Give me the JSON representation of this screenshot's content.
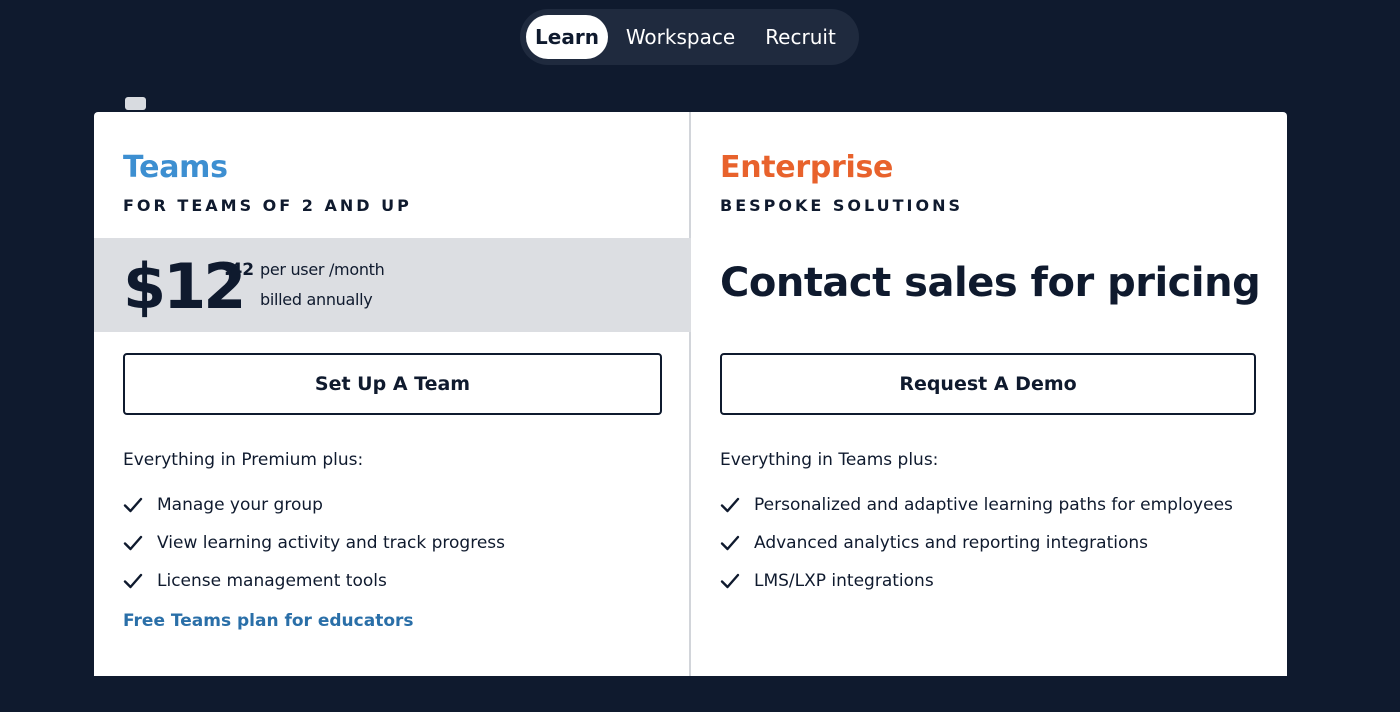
{
  "tabs": [
    {
      "label": "Learn",
      "active": true
    },
    {
      "label": "Workspace",
      "active": false
    },
    {
      "label": "Recruit",
      "active": false
    }
  ],
  "teams": {
    "name": "Teams",
    "subtitle": "FOR TEAMS OF 2 AND UP",
    "price": {
      "amount": "$12",
      "cents": ".42",
      "unit": "per user /month",
      "billing": "billed annually"
    },
    "cta_label": "Set Up A Team",
    "features_intro": "Everything in Premium plus:",
    "features": [
      "Manage your group",
      "View learning activity and track progress",
      "License management tools"
    ],
    "link_label": "Free Teams plan for educators"
  },
  "enterprise": {
    "name": "Enterprise",
    "subtitle": "BESPOKE SOLUTIONS",
    "contact": "Contact sales for pricing",
    "cta_label": "Request A Demo",
    "features_intro": "Everything in Teams plus:",
    "features": [
      "Personalized and adaptive learning paths for employees",
      "Advanced analytics and reporting integrations",
      "LMS/LXP integrations"
    ]
  },
  "colors": {
    "background": "#0f1a2e",
    "teams_accent": "#3d8fd1",
    "enterprise_accent": "#e8622c",
    "link": "#2a6fa8"
  },
  "icons": {
    "feature_bullet": "checkmark-icon"
  }
}
